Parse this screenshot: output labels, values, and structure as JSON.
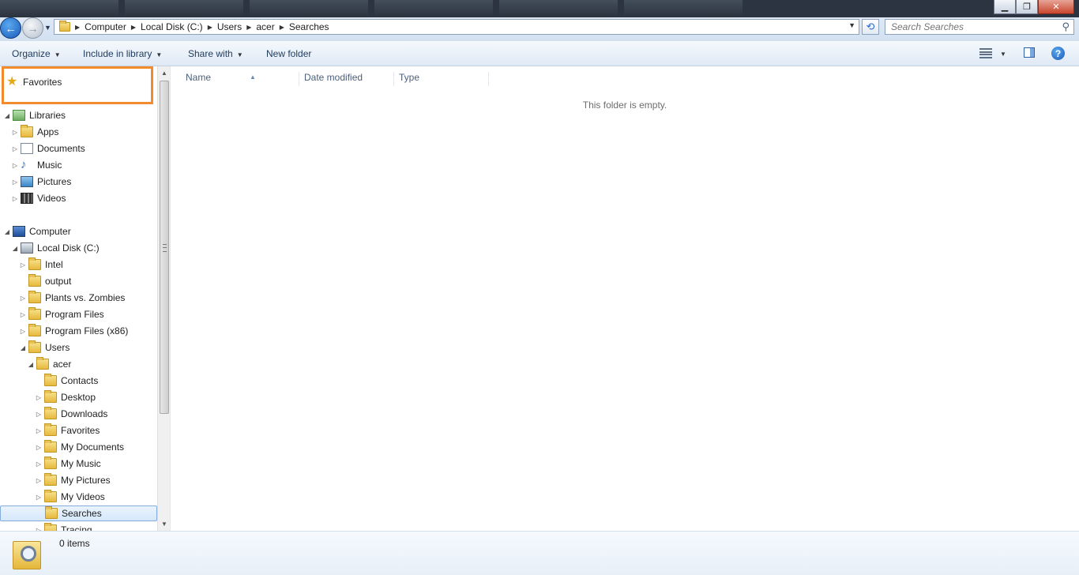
{
  "window": {
    "minimize_label": "▁",
    "maximize_label": "❐",
    "close_label": "✕"
  },
  "address_bar": {
    "crumbs": [
      "Computer",
      "Local Disk (C:)",
      "Users",
      "acer",
      "Searches"
    ]
  },
  "search": {
    "placeholder": "Search Searches"
  },
  "command_bar": {
    "organize": "Organize",
    "include_in_library": "Include in library",
    "share_with": "Share with",
    "new_folder": "New folder"
  },
  "nav_pane": {
    "favorites": "Favorites",
    "libraries": "Libraries",
    "libraries_items": [
      "Apps",
      "Documents",
      "Music",
      "Pictures",
      "Videos"
    ],
    "computer": "Computer",
    "local_disk": "Local Disk (C:)",
    "drive_items": [
      "Intel",
      "output",
      "Plants vs. Zombies",
      "Program Files",
      "Program Files (x86)",
      "Users"
    ],
    "users_child": "acer",
    "acer_items": [
      "Contacts",
      "Desktop",
      "Downloads",
      "Favorites",
      "My Documents",
      "My Music",
      "My Pictures",
      "My Videos",
      "Searches",
      "Tracing"
    ],
    "selected": "Searches"
  },
  "columns": {
    "name": "Name",
    "date_modified": "Date modified",
    "type": "Type"
  },
  "content": {
    "empty_message": "This folder is empty."
  },
  "details": {
    "item_count": "0 items"
  },
  "colors": {
    "highlight_box": "#f28a2e",
    "selection_border": "#84acdd"
  }
}
